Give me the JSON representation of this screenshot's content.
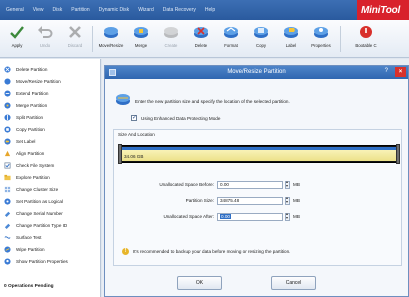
{
  "menu": [
    "General",
    "View",
    "Disk",
    "Partition",
    "Dynamic Disk",
    "Wizard",
    "Data Recovery",
    "Help"
  ],
  "brand": "MiniTool",
  "toolbar": {
    "apply": "Apply",
    "undo": "Undo",
    "discard": "Discard",
    "move_resize": "Move/Resize",
    "merge": "Merge",
    "create": "Create",
    "delete": "Delete",
    "format": "Format",
    "copy": "Copy",
    "label": "Label",
    "properties": "Properties",
    "bootable": "Bootable C"
  },
  "sidebar": {
    "items": [
      {
        "label": "Delete Partition",
        "icon": "delete-icon"
      },
      {
        "label": "Move/Resize Partition",
        "icon": "move-resize-icon"
      },
      {
        "label": "Extend Partition",
        "icon": "extend-icon"
      },
      {
        "label": "Merge Partition",
        "icon": "merge-icon"
      },
      {
        "label": "Split Partition",
        "icon": "split-icon"
      },
      {
        "label": "Copy Partition",
        "icon": "copy-icon"
      },
      {
        "label": "Set Label",
        "icon": "label-icon"
      },
      {
        "label": "Align Partition",
        "icon": "align-icon"
      },
      {
        "label": "Check File System",
        "icon": "check-icon"
      },
      {
        "label": "Explore Partition",
        "icon": "explore-icon"
      },
      {
        "label": "Change Cluster Size",
        "icon": "cluster-icon"
      },
      {
        "label": "Set Partition as Logical",
        "icon": "logical-icon"
      },
      {
        "label": "Change Serial Number",
        "icon": "serial-icon"
      },
      {
        "label": "Change Partition Type ID",
        "icon": "type-id-icon"
      },
      {
        "label": "Surface Test",
        "icon": "surface-icon"
      },
      {
        "label": "Wipe Partition",
        "icon": "wipe-icon"
      },
      {
        "label": "Show Partition Properties",
        "icon": "properties-icon"
      }
    ],
    "footer": "0 Operations Pending"
  },
  "dialog": {
    "title": "Move/Resize Partition",
    "help": "?",
    "close": "×",
    "intro": "Enter the new partition size and specify the location of the selected partition.",
    "checkbox_label": "Using Enhanced Data Protecting Mode",
    "checkbox_checked": true,
    "group_title": "Size And Location",
    "bar_text": "34.06 GB",
    "fields": [
      {
        "label": "Unallocated Space Before:",
        "value": "0.00",
        "unit": "MB"
      },
      {
        "label": "Partition Size:",
        "value": "34875.48",
        "unit": "MB"
      },
      {
        "label": "Unallocated Space After:",
        "value": "0.00",
        "unit": "MB"
      }
    ],
    "note": "It's recommended to backup your data before moving or resizing the partition.",
    "ok": "OK",
    "cancel": "Cancel"
  },
  "colors": {
    "menubar": "#2f60a6",
    "brand": "#d8212b",
    "title_bar": "#3a73bd",
    "partition_bar": "#2f6fc6",
    "partition_fill": "#f3eba5"
  }
}
